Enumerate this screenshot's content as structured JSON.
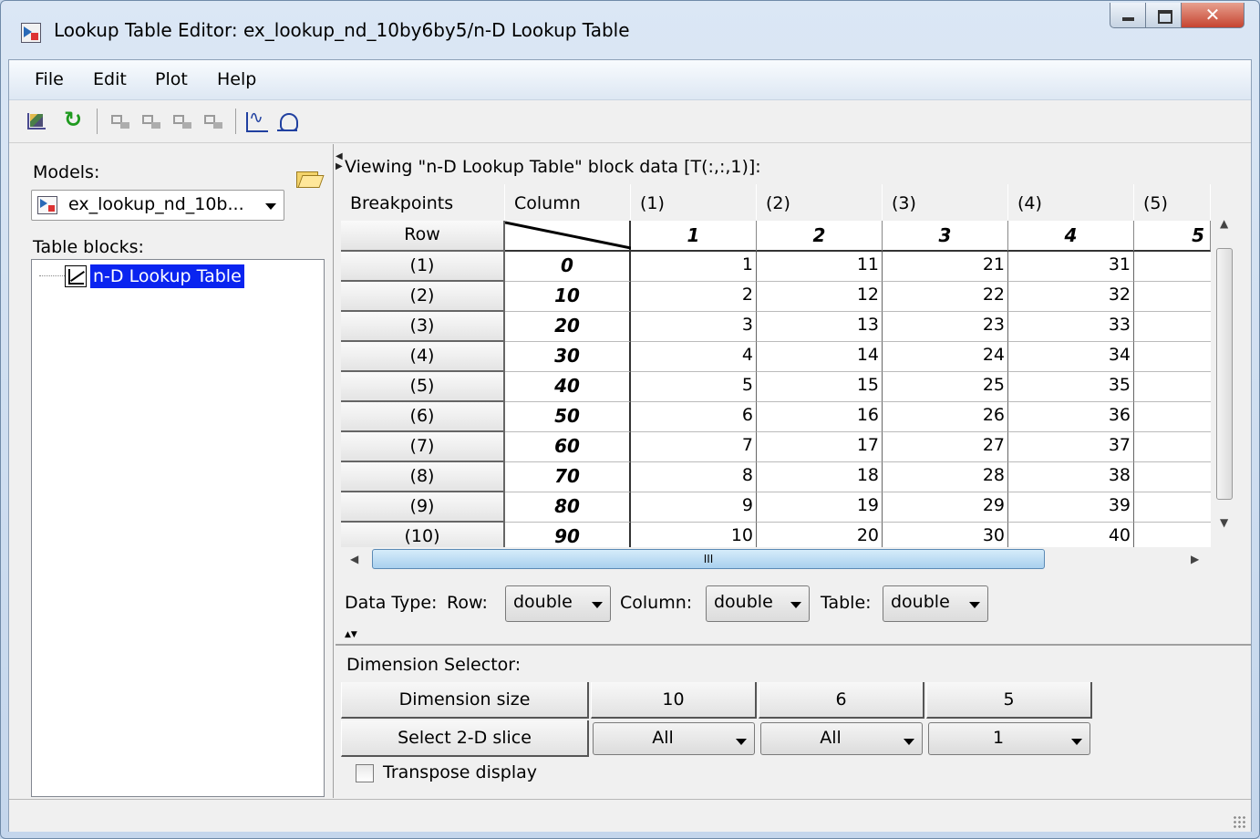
{
  "window": {
    "title": "Lookup Table Editor: ex_lookup_nd_10by6by5/n-D Lookup Table"
  },
  "menu": [
    "File",
    "Edit",
    "Plot",
    "Help"
  ],
  "toolbar": {
    "icons": [
      "chart-icon",
      "refresh-icon",
      "add-row-icon",
      "delete-row-icon",
      "resize-icon",
      "remove-icon",
      "line-plot-icon",
      "mesh-plot-icon"
    ]
  },
  "left": {
    "models_label": "Models:",
    "model_value": "ex_lookup_nd_10b...",
    "table_blocks_label": "Table blocks:",
    "tree_item": "n-D Lookup Table"
  },
  "viewing_text": "Viewing \"n-D Lookup Table\" block data [T(:,:,1)]:",
  "table": {
    "header_breakpoints": "Breakpoints",
    "header_column": "Column",
    "col_headers": [
      "(1)",
      "(2)",
      "(3)",
      "(4)",
      "(5)"
    ],
    "row_label": "Row",
    "col_breakpoints": [
      "1",
      "2",
      "3",
      "4",
      "5"
    ],
    "row_headers": [
      "(1)",
      "(2)",
      "(3)",
      "(4)",
      "(5)",
      "(6)",
      "(7)",
      "(8)",
      "(9)",
      "(10)"
    ],
    "row_breakpoints": [
      "0",
      "10",
      "20",
      "30",
      "40",
      "50",
      "60",
      "70",
      "80",
      "90"
    ],
    "values": [
      [
        "1",
        "11",
        "21",
        "31"
      ],
      [
        "2",
        "12",
        "22",
        "32"
      ],
      [
        "3",
        "13",
        "23",
        "33"
      ],
      [
        "4",
        "14",
        "24",
        "34"
      ],
      [
        "5",
        "15",
        "25",
        "35"
      ],
      [
        "6",
        "16",
        "26",
        "36"
      ],
      [
        "7",
        "17",
        "27",
        "37"
      ],
      [
        "8",
        "18",
        "28",
        "38"
      ],
      [
        "9",
        "19",
        "29",
        "39"
      ],
      [
        "10",
        "20",
        "30",
        "40"
      ]
    ],
    "hscroll_grip": "III"
  },
  "data_type": {
    "label": "Data Type:",
    "row_label": "Row:",
    "row_value": "double",
    "column_label": "Column:",
    "column_value": "double",
    "table_label": "Table:",
    "table_value": "double"
  },
  "dimension": {
    "title": "Dimension Selector:",
    "size_label": "Dimension size",
    "sizes": [
      "10",
      "6",
      "5"
    ],
    "slice_label": "Select 2-D slice",
    "slices": [
      "All",
      "All",
      "1"
    ]
  },
  "transpose_label": "Transpose display"
}
